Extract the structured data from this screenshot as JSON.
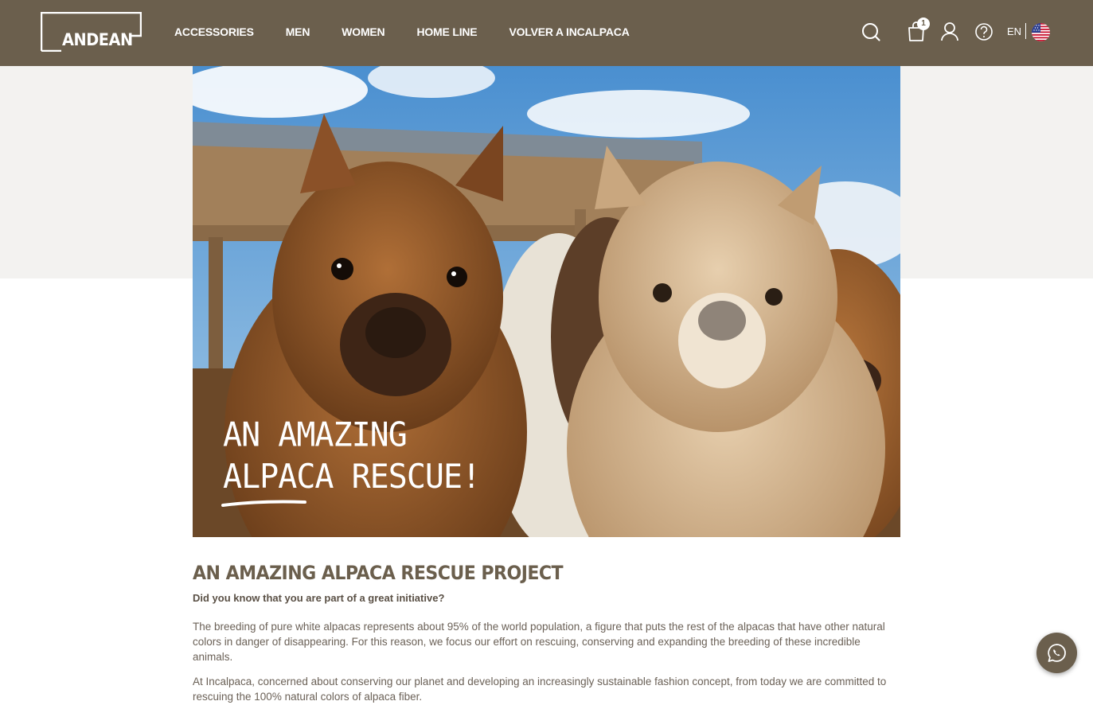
{
  "header": {
    "logo_text": "ANDEAN",
    "nav": [
      {
        "label": "ACCESSORIES"
      },
      {
        "label": "MEN"
      },
      {
        "label": "WOMEN"
      },
      {
        "label": "HOME LINE"
      },
      {
        "label": "VOLVER A INCALPACA"
      }
    ],
    "cart_count": "1",
    "language": "EN",
    "icons": [
      "search-icon",
      "cart-icon",
      "user-icon",
      "help-icon",
      "us-flag-icon"
    ]
  },
  "hero": {
    "title_line1": "AN AMAZING",
    "title_line2_a": "ALPACA",
    "title_line2_b": " RESCUE!"
  },
  "article": {
    "title": "AN AMAZING ALPACA RESCUE PROJECT",
    "subtitle": "Did you know that you are part of a great initiative?",
    "paragraphs": [
      "The breeding of pure white alpacas represents about 95% of the world population, a figure that puts the rest of the alpacas that have other natural colors in danger of disappearing. For this reason, we focus our effort on rescuing, conserving and expanding the breeding of these incredible animals.",
      "At Incalpaca, concerned about conserving our planet and developing an increasingly sustainable fashion concept, from today we are committed to rescuing the 100% natural colors of alpaca fiber."
    ]
  },
  "colors": {
    "brand": "#6b5f4d",
    "hero_band": "#f3f2f0",
    "text": "#6b6157"
  }
}
